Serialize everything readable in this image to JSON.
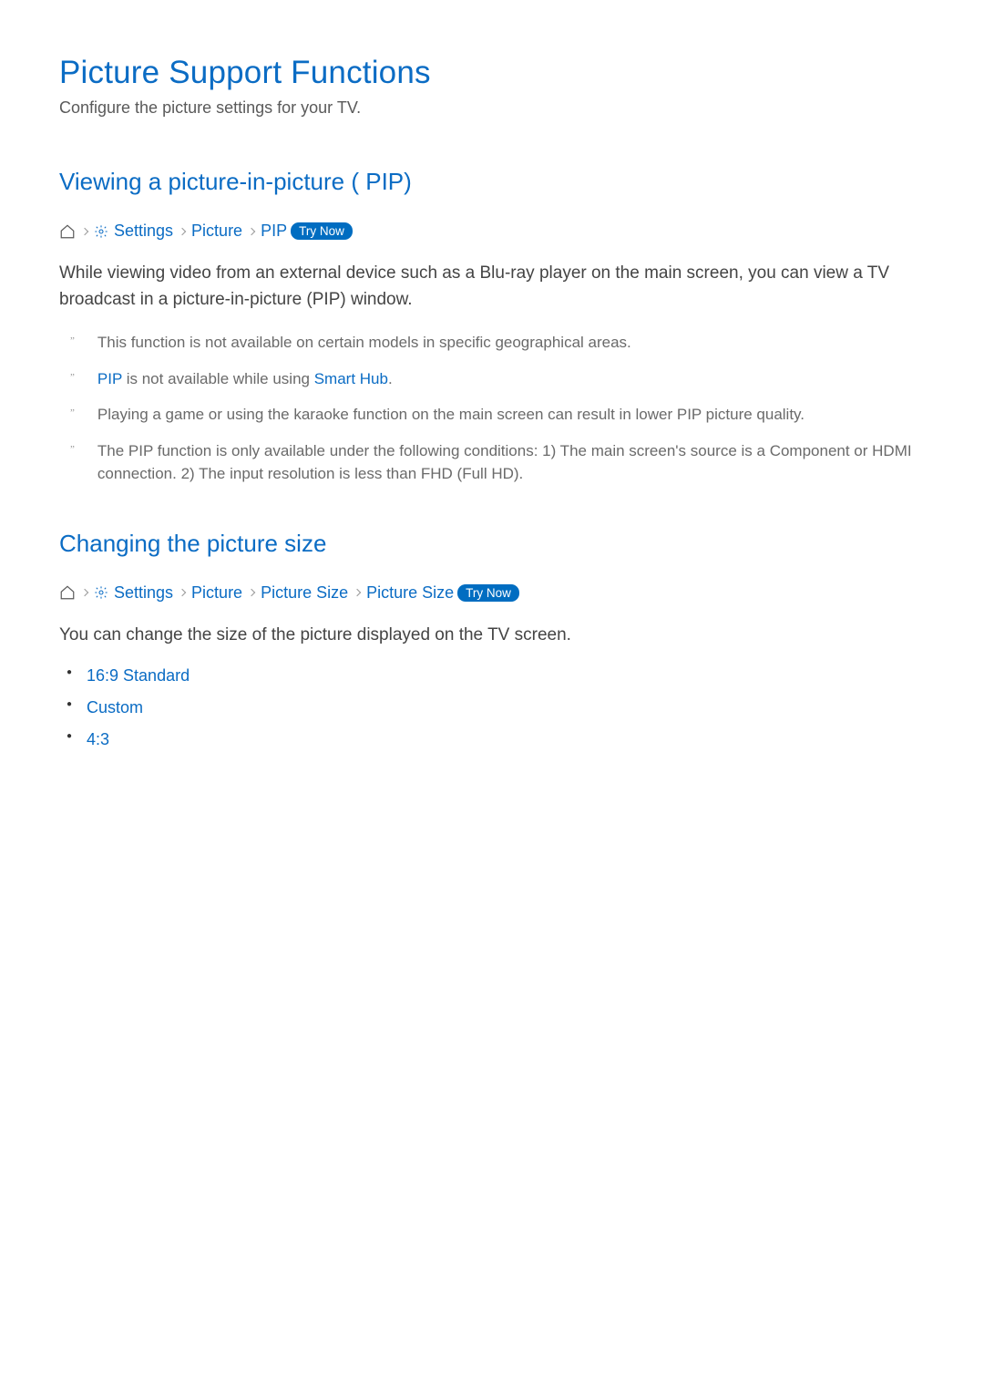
{
  "title": "Picture Support Functions",
  "subtitle": "Configure the picture settings for your TV.",
  "try_now_label": "Try Now",
  "section_pip": {
    "heading": "Viewing a picture-in-picture ( PIP)",
    "path": {
      "settings": "Settings",
      "picture": "Picture",
      "pip": "PIP"
    },
    "description": "While viewing video from an external device such as a Blu-ray player on the main screen, you can view a TV broadcast in a picture-in-picture (PIP) window.",
    "notes": [
      {
        "text": "This function is not available on certain models in specific geographical areas."
      },
      {
        "prefix_blue": "PIP",
        "middle": " is not available while using ",
        "suffix_blue": "Smart Hub",
        "end": "."
      },
      {
        "text": "Playing a game or using the karaoke function on the main screen can result in lower PIP picture quality."
      },
      {
        "text": "The PIP function is only available under the following conditions: 1) The main screen's source is a Component or HDMI connection. 2) The input resolution is less than FHD (Full HD)."
      }
    ]
  },
  "section_size": {
    "heading": "Changing the picture size",
    "path": {
      "settings": "Settings",
      "picture": "Picture",
      "picture_size_menu": "Picture Size",
      "picture_size": "Picture Size"
    },
    "description": "You can change the size of the picture displayed on the TV screen.",
    "options": [
      "16:9 Standard",
      "Custom",
      "4:3"
    ]
  }
}
